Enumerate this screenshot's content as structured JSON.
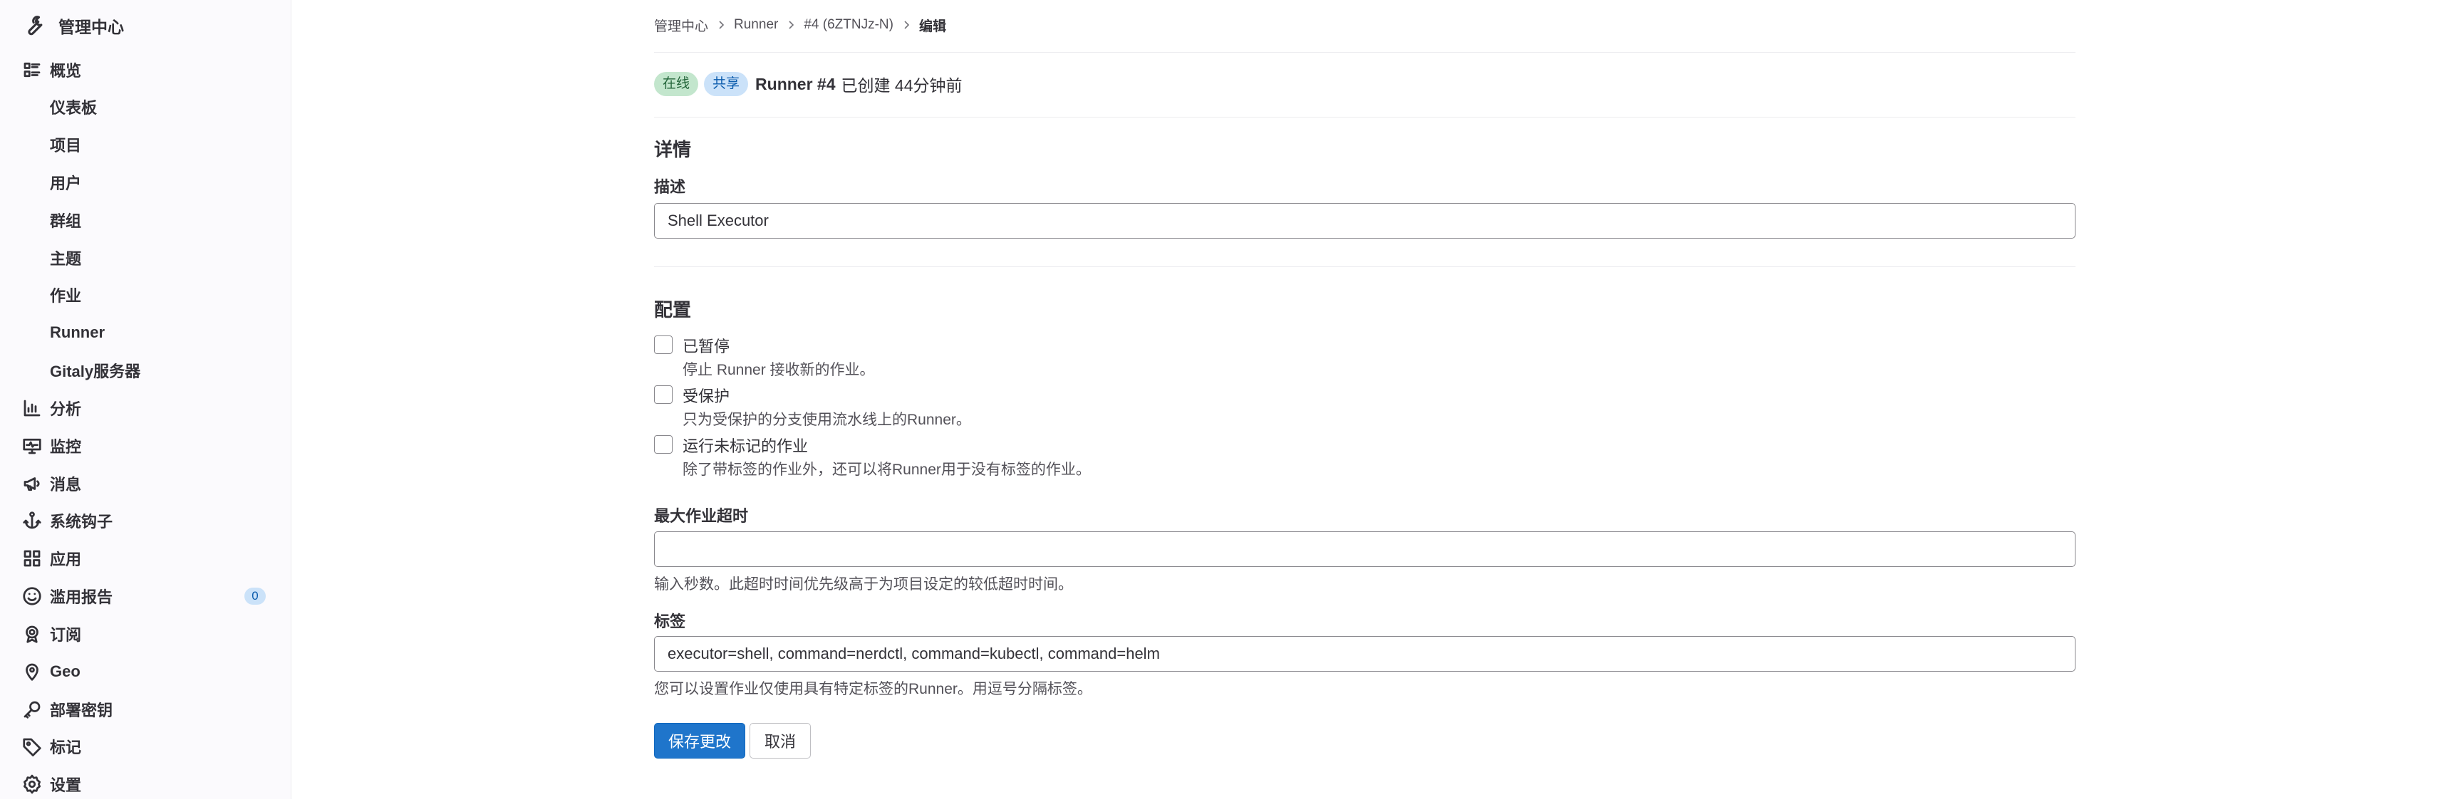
{
  "sidebar": {
    "title": "管理中心",
    "overview_label": "概览",
    "overview_items": [
      {
        "label": "仪表板"
      },
      {
        "label": "项目"
      },
      {
        "label": "用户"
      },
      {
        "label": "群组"
      },
      {
        "label": "主题"
      },
      {
        "label": "作业"
      },
      {
        "label": "Runner"
      },
      {
        "label": "Gitaly服务器"
      }
    ],
    "sections": [
      {
        "label": "分析",
        "icon": "chart-icon"
      },
      {
        "label": "监控",
        "icon": "monitor-icon"
      },
      {
        "label": "消息",
        "icon": "bullhorn-icon"
      },
      {
        "label": "系统钩子",
        "icon": "anchor-icon"
      },
      {
        "label": "应用",
        "icon": "applications-icon"
      },
      {
        "label": "滥用报告",
        "icon": "smiley-icon",
        "badge": "0"
      },
      {
        "label": "订阅",
        "icon": "subscription-icon"
      },
      {
        "label": "Geo",
        "icon": "location-icon"
      },
      {
        "label": "部署密钥",
        "icon": "key-icon"
      },
      {
        "label": "标记",
        "icon": "label-icon"
      },
      {
        "label": "设置",
        "icon": "settings-icon"
      }
    ]
  },
  "breadcrumb": {
    "items": [
      "管理中心",
      "Runner",
      "#4 (6ZTNJz-N)"
    ],
    "current": "编辑"
  },
  "runner": {
    "status": "在线",
    "type": "共享",
    "name": "Runner #4",
    "created": "已创建 44分钟前"
  },
  "details": {
    "heading": "详情",
    "description_label": "描述",
    "description_value": "Shell Executor"
  },
  "config": {
    "heading": "配置",
    "options": [
      {
        "title": "已暂停",
        "help": "停止 Runner 接收新的作业。",
        "checked": false
      },
      {
        "title": "受保护",
        "help": "只为受保护的分支使用流水线上的Runner。",
        "checked": false
      },
      {
        "title": "运行未标记的作业",
        "help": "除了带标签的作业外，还可以将Runner用于没有标签的作业。",
        "checked": false
      }
    ],
    "timeout_label": "最大作业超时",
    "timeout_value": "",
    "timeout_help": "输入秒数。此超时时间优先级高于为项目设定的较低超时时间。",
    "tags_label": "标签",
    "tags_value": "executor=shell, command=nerdctl, command=kubectl, command=helm",
    "tags_help": "您可以设置作业仅使用具有特定标签的Runner。用逗号分隔标签。"
  },
  "actions": {
    "save": "保存更改",
    "cancel": "取消"
  },
  "colors": {
    "primary": "#1f75cb",
    "online_bg": "#c3e6cd",
    "shared_bg": "#cbe2f9",
    "sidebar_bg": "#fbfafd"
  }
}
